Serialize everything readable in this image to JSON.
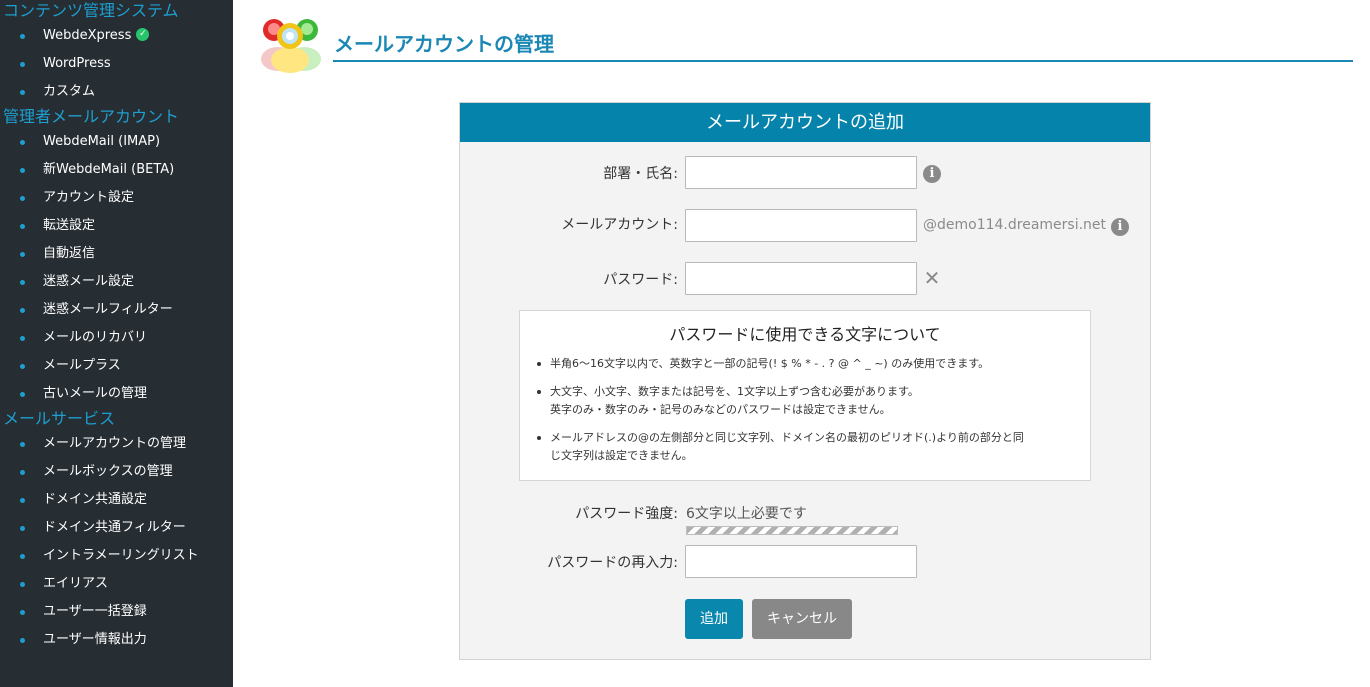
{
  "sidebar": {
    "sections": [
      {
        "title": "コンテンツ管理システム",
        "items": [
          {
            "label": "WebdeXpress",
            "badge": "check-icon"
          },
          {
            "label": "WordPress"
          },
          {
            "label": "カスタム"
          }
        ]
      },
      {
        "title": "管理者メールアカウント",
        "items": [
          {
            "label": "WebdeMail (IMAP)"
          },
          {
            "label": "新WebdeMail (BETA)"
          },
          {
            "label": "アカウント設定"
          },
          {
            "label": "転送設定"
          },
          {
            "label": "自動返信"
          },
          {
            "label": "迷惑メール設定"
          },
          {
            "label": "迷惑メールフィルター"
          },
          {
            "label": "メールのリカバリ"
          },
          {
            "label": "メールプラス"
          },
          {
            "label": "古いメールの管理"
          }
        ]
      },
      {
        "title": "メールサービス",
        "items": [
          {
            "label": "メールアカウントの管理"
          },
          {
            "label": "メールボックスの管理"
          },
          {
            "label": "ドメイン共通設定"
          },
          {
            "label": "ドメイン共通フィルター"
          },
          {
            "label": "イントラメーリングリスト"
          },
          {
            "label": "エイリアス"
          },
          {
            "label": "ユーザー一括登録"
          },
          {
            "label": "ユーザー情報出力"
          }
        ]
      }
    ]
  },
  "header": {
    "title": "メールアカウントの管理"
  },
  "form": {
    "title": "メールアカウントの追加",
    "name_label": "部署・氏名:",
    "name_value": "",
    "account_label": "メールアカウント:",
    "account_value": "",
    "domain_suffix": "@demo114.dreamersi.net",
    "password_label": "パスワード:",
    "password_value": "",
    "rules": {
      "title": "パスワードに使用できる文字について",
      "items": [
        {
          "lines": [
            "半角6〜16文字以内で、英数字と一部の記号(! $ % * - . ? @ ^ _ ~) のみ使用できます。"
          ]
        },
        {
          "lines": [
            "大文字、小文字、数字または記号を、1文字以上ずつ含む必要があります。",
            "英字のみ・数字のみ・記号のみなどのパスワードは設定できません。"
          ]
        },
        {
          "lines": [
            "メールアドレスの@の左側部分と同じ文字列、ドメイン名の最初のピリオド(.)より前の部分と同",
            "じ文字列は設定できません。"
          ]
        }
      ]
    },
    "strength_label": "パスワード強度:",
    "strength_text": "6文字以上必要です",
    "strength_level": 0,
    "confirm_label": "パスワードの再入力:",
    "confirm_value": "",
    "add_button": "追加",
    "cancel_button": "キャンセル"
  },
  "colors": {
    "sidebar_bg": "#262d33",
    "accent": "#1a87b4",
    "panel_header": "#0683aa",
    "cancel": "#888888",
    "badge": "#27c46b"
  }
}
